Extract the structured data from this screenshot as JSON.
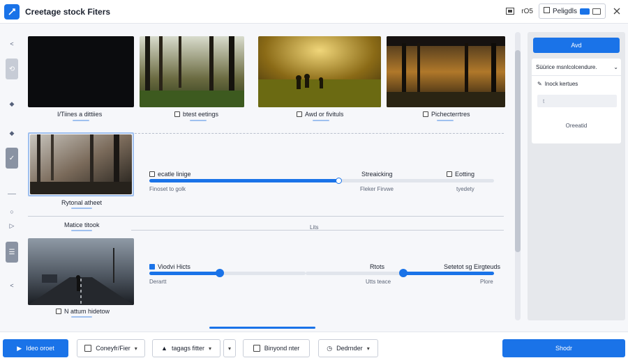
{
  "window": {
    "title": "Creetage stock Fiters",
    "count": "rO5",
    "profile_label": "Peligdls"
  },
  "rail": {
    "collapse_glyph": "<",
    "expand_glyph": "<"
  },
  "thumbnails": [
    {
      "caption": "I/Tiines a dittiies",
      "checked": false
    },
    {
      "caption": "btest eetings",
      "checked": false
    },
    {
      "caption": "Awd or fivituls",
      "checked": false
    },
    {
      "caption": "Pichecterrtres",
      "checked": false
    }
  ],
  "section_a": {
    "image_caption": "Rytonal atheet",
    "control_1": {
      "label": "ecatle linige",
      "sub": "Finoset to golk",
      "value": 0.55
    },
    "control_2": {
      "label": "Streaicking",
      "sub": "Fleker Firvwe"
    },
    "control_3": {
      "label": "Eotting",
      "sub": "tyedety"
    }
  },
  "section_b": {
    "title": "Matice titook",
    "center_label": "Lits"
  },
  "section_c": {
    "image_caption": "N attum hidetow",
    "control_1": {
      "label": "Viodvi Hicts",
      "sub": "Derartt",
      "value": 0.45
    },
    "control_2": {
      "label": "Rtots",
      "sub": "Utts teace"
    },
    "control_3": {
      "label": "Setetot sg Eirgteuds",
      "sub": "Plore",
      "value": 0.7
    }
  },
  "panel": {
    "primary_button": "Avd",
    "select_label": "Süürice msnlcolcendure.",
    "item_label": "Inock kertues",
    "input_placeholder": "t",
    "status": "Oreeatid"
  },
  "bottombar": {
    "video_button": "Ideo oroet",
    "filter_dropdown": "Coneyfr/Fier",
    "tags_dropdown": "tagags fitter",
    "beyond_dropdown": "Binyond nter",
    "decoder_dropdown": "Dedrnder",
    "primary_button": "Shodr"
  },
  "colors": {
    "accent": "#1a73e8",
    "panel_bg": "#e6e8ec"
  }
}
